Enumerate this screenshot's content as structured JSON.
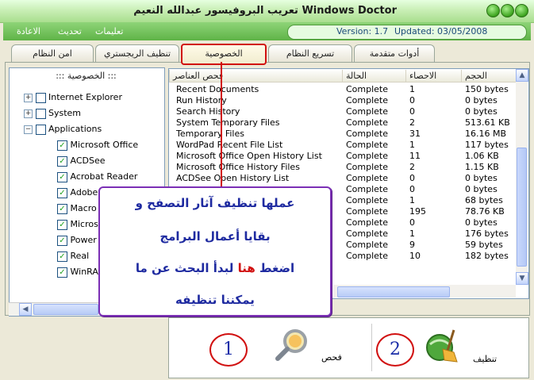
{
  "window": {
    "title": "تعريب البروفيسور عبدالله النعيم Windows Doctor"
  },
  "menubar": {
    "items": [
      "تعليمات",
      "تحديث",
      "الاعادة"
    ],
    "version": "Version: 1.7",
    "updated": "Updated: 03/05/2008"
  },
  "tabs": [
    "أدوات متقدمة",
    "تسريع النظام",
    "الخصوصية",
    "تنظيف الريجستري",
    "امن النظام"
  ],
  "tree": {
    "header": "::: الخصوصية :::",
    "roots": [
      "Internet Explorer",
      "System",
      "Applications"
    ],
    "apps": [
      "Microsoft Office",
      "ACDSee",
      "Acrobat Reader",
      "Adobe",
      "Macro",
      "Micros",
      "Power",
      "Real",
      "WinRA"
    ]
  },
  "list": {
    "columns": [
      "فحص العناصر",
      "الحالة",
      "الاحصاء",
      "الحجم"
    ],
    "rows": [
      [
        "Recent Documents",
        "Complete",
        "1",
        "150 bytes"
      ],
      [
        "Run History",
        "Complete",
        "0",
        "0 bytes"
      ],
      [
        "Search History",
        "Complete",
        "0",
        "0 bytes"
      ],
      [
        "System Temporary Files",
        "Complete",
        "2",
        "513.61 KB"
      ],
      [
        "Temporary Files",
        "Complete",
        "31",
        "16.16 MB"
      ],
      [
        "WordPad Recent File List",
        "Complete",
        "1",
        "117 bytes"
      ],
      [
        "Microsoft Office Open History List",
        "Complete",
        "11",
        "1.06 KB"
      ],
      [
        "Microsoft Office History Files",
        "Complete",
        "2",
        "1.15 KB"
      ],
      [
        "ACDSee Open History List",
        "Complete",
        "0",
        "0 bytes"
      ],
      [
        "",
        "Complete",
        "0",
        "0 bytes"
      ],
      [
        "",
        "Complete",
        "1",
        "68 bytes"
      ],
      [
        "",
        "Complete",
        "195",
        "78.76 KB"
      ],
      [
        "",
        "Complete",
        "0",
        "0 bytes"
      ],
      [
        "",
        "Complete",
        "1",
        "176 bytes"
      ],
      [
        "",
        "Complete",
        "9",
        "59 bytes"
      ],
      [
        "",
        "Complete",
        "10",
        "182 bytes"
      ]
    ]
  },
  "callout": {
    "line1": "عملها تنظيف آثار التصفح و",
    "line2": "بقايا أعمال البرامج",
    "line3_a": "اضغط",
    "line3_b": "هنا",
    "line3_c": "لبدأ البحث عن ما",
    "line4": "يمكننا تنظيفه"
  },
  "actions": {
    "scan_label": "فحص",
    "clean_label": "تنظيف",
    "scan_step": "1",
    "clean_step": "2"
  }
}
